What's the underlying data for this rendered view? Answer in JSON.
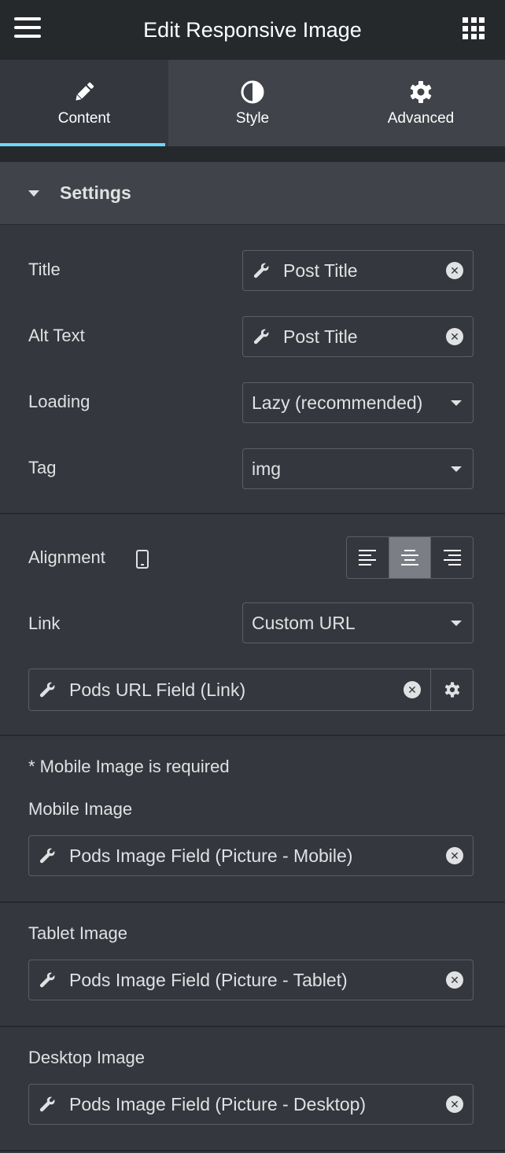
{
  "header": {
    "title": "Edit Responsive Image",
    "menu_icon": "hamburger-icon",
    "apps_icon": "grid-icon"
  },
  "tabs": [
    {
      "label": "Content",
      "icon": "pencil-icon",
      "active": true
    },
    {
      "label": "Style",
      "icon": "contrast-icon",
      "active": false
    },
    {
      "label": "Advanced",
      "icon": "gear-icon",
      "active": false
    }
  ],
  "section": {
    "title": "Settings"
  },
  "fields": {
    "title": {
      "label": "Title",
      "value": "Post Title"
    },
    "alt_text": {
      "label": "Alt Text",
      "value": "Post Title"
    },
    "loading": {
      "label": "Loading",
      "value": "Lazy (recommended)"
    },
    "tag": {
      "label": "Tag",
      "value": "img"
    },
    "alignment": {
      "label": "Alignment",
      "value": "center",
      "device_icon": "mobile-icon"
    },
    "link": {
      "label": "Link",
      "value": "Custom URL"
    },
    "link_field": {
      "value": "Pods URL Field (Link)"
    },
    "required_note": "* Mobile Image is required",
    "mobile_image": {
      "label": "Mobile Image",
      "value": "Pods Image Field (Picture - Mobile)"
    },
    "tablet_image": {
      "label": "Tablet Image",
      "value": "Pods Image Field (Picture - Tablet)"
    },
    "desktop_image": {
      "label": "Desktop Image",
      "value": "Pods Image Field (Picture - Desktop)"
    }
  },
  "colors": {
    "header_bg": "#26292c",
    "panel_bg": "#34373d",
    "tab_bg": "#404349",
    "accent": "#71d7f7",
    "text": "#e0e1e3"
  }
}
